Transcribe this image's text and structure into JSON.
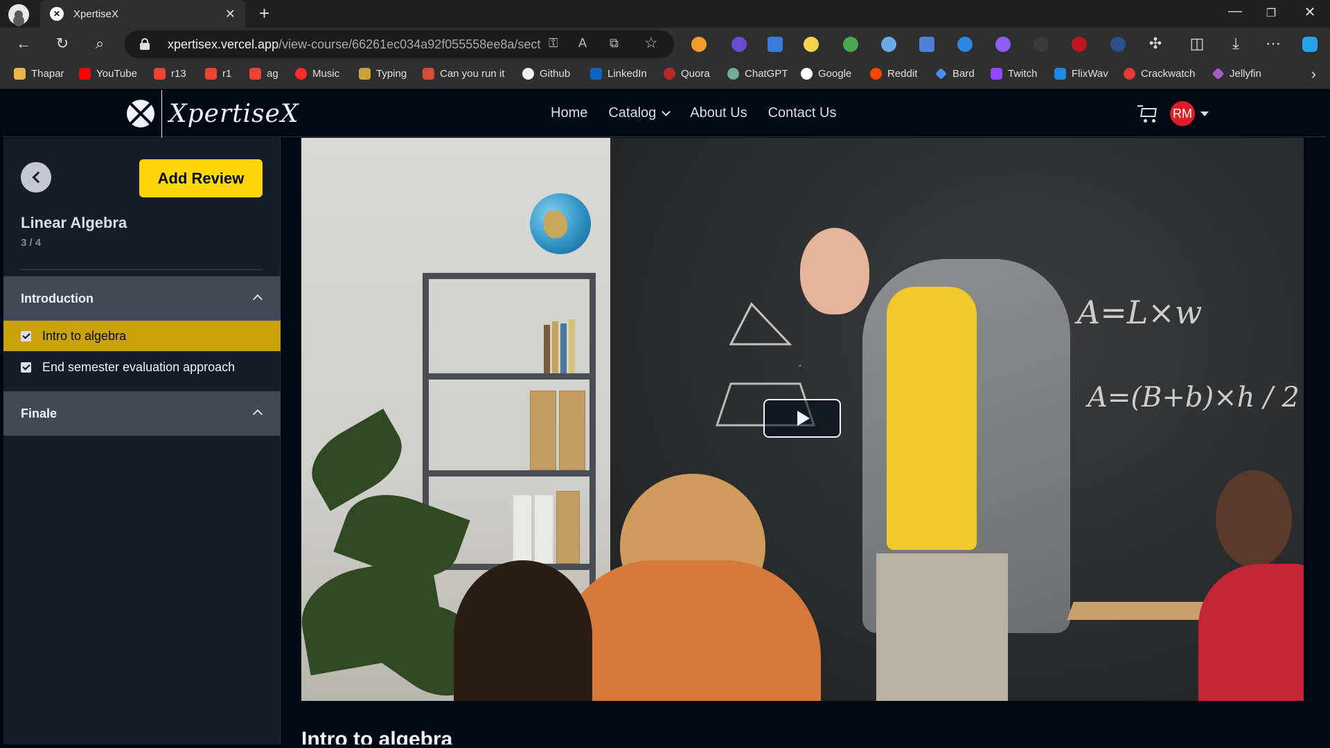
{
  "browser": {
    "tab_title": "XpertiseX",
    "url_host": "xpertisex.vercel.app",
    "url_path": "/view-course/66261ec034a92f055558ee8a/sect...",
    "bookmarks": [
      "Thapar",
      "YouTube",
      "r13",
      "r1",
      "ag",
      "Music",
      "Typing",
      "Can you run it",
      "Github",
      "LinkedIn",
      "Quora",
      "ChatGPT",
      "Google",
      "Reddit",
      "Bard",
      "Twitch",
      "FlixWav",
      "Crackwatch",
      "Jellyfin"
    ]
  },
  "header": {
    "logo_text": "XpertiseX",
    "nav": [
      "Home",
      "Catalog",
      "About Us",
      "Contact Us"
    ],
    "avatar_initials": "RM"
  },
  "sidebar": {
    "add_review_label": "Add Review",
    "course_title": "Linear Algebra",
    "progress": "3 / 4",
    "sections": [
      {
        "title": "Introduction",
        "lectures": [
          {
            "title": "Intro to algebra",
            "completed": true,
            "active": true
          },
          {
            "title": "End semester evaluation approach",
            "completed": true,
            "active": false
          }
        ]
      },
      {
        "title": "Finale",
        "lectures": []
      }
    ]
  },
  "video": {
    "chalk_formula_1": "A=L×w",
    "chalk_formula_2": "A=(B+b)×h / 2"
  },
  "lecture_heading": "Intro to algebra"
}
